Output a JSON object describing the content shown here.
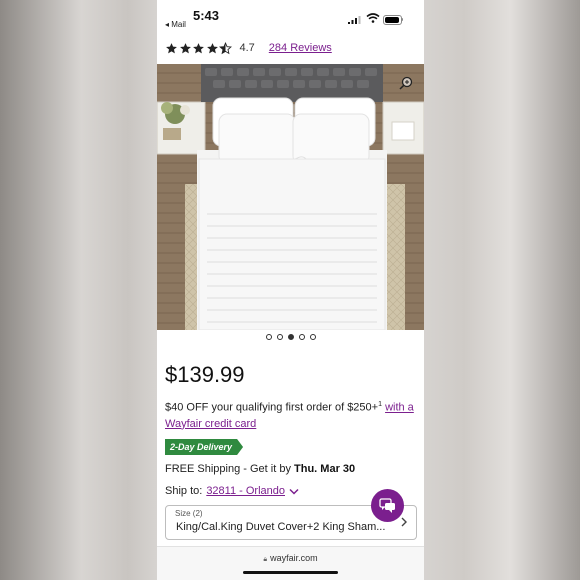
{
  "status_bar": {
    "time": "5:43",
    "back_label": "◂ Mail"
  },
  "rating": {
    "stars": 4.7,
    "value": "4.7",
    "reviews_link": "284 Reviews"
  },
  "gallery": {
    "image_count": 5,
    "active_index": 3
  },
  "price": "$139.99",
  "promo": {
    "text": "$40 OFF your qualifying first order of $250+",
    "superscript": "1",
    "link": "with a Wayfair credit card"
  },
  "delivery_badge": "2-Day Delivery",
  "shipping": {
    "prefix": "FREE Shipping - Get it by",
    "date": "Thu. Mar 30"
  },
  "ship_to": {
    "label": "Ship to:",
    "location": "32811 - Orlando"
  },
  "size_selector": {
    "label": "Size (2)",
    "value": "King/Cal.King Duvet Cover+2 King Sham..."
  },
  "browser": {
    "url": "wayfair.com"
  },
  "colors": {
    "accent_purple": "#7b1f8e",
    "badge_green": "#2f8a3f"
  },
  "icons": [
    "star-icon",
    "zoom-in-icon",
    "chevron-down-icon",
    "chevron-right-icon",
    "chat-icon",
    "lock-icon"
  ]
}
